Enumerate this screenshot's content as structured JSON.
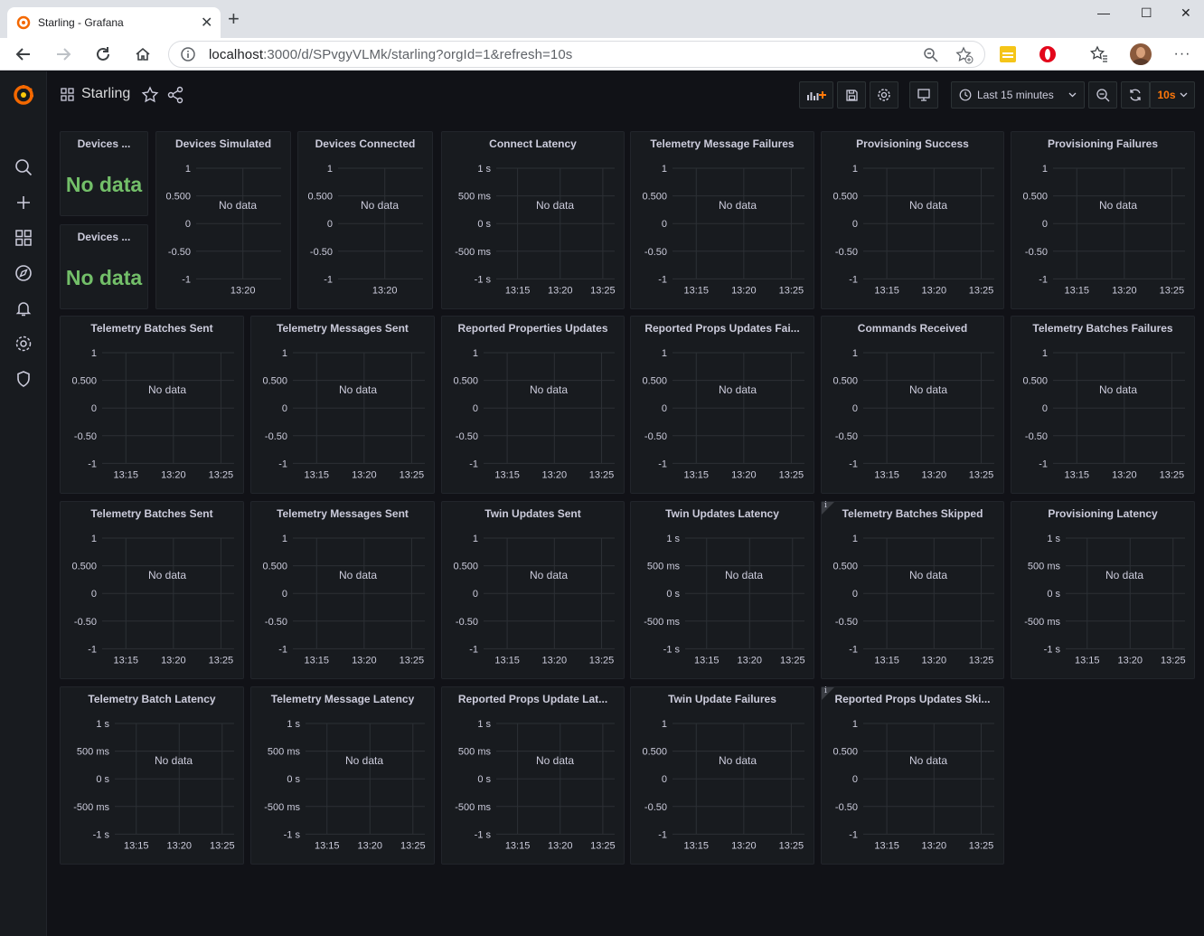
{
  "browser": {
    "tab_title": "Starling - Grafana",
    "url_host": "localhost",
    "url_rest": ":3000/d/SPvgyVLMk/starling?orgId=1&refresh=10s",
    "icons": [
      "back-icon",
      "forward-icon",
      "reload-icon",
      "home-icon",
      "info-icon",
      "zoom-icon",
      "favorite-add-icon",
      "extension-icon",
      "opera-icon",
      "favorites-icon",
      "profile-avatar",
      "more-icon"
    ]
  },
  "sidemenu": {
    "icons": [
      "grafana-logo",
      "search-icon",
      "plus-icon",
      "dashboards-icon",
      "explore-icon",
      "alert-bell-icon",
      "gear-icon",
      "shield-icon"
    ]
  },
  "navbar": {
    "title": "Starling",
    "time_range": "Last 15 minutes",
    "refresh": "10s"
  },
  "colors": {
    "accent": "#ff780a",
    "stat_green": "#73bf69",
    "bg": "#111217",
    "panel": "#181b1f"
  },
  "stat_panels": [
    {
      "title": "Devices ...",
      "value": "No data"
    },
    {
      "title": "Devices ...",
      "value": "No data"
    }
  ],
  "no_data": "No data",
  "axis_sets": {
    "num": [
      "1",
      "0.500",
      "0",
      "-0.50",
      "-1"
    ],
    "ms": [
      "1 s",
      "500 ms",
      "0 s",
      "-500 ms",
      "-1 s"
    ]
  },
  "panels": [
    {
      "title": "Devices Simulated",
      "axis": "num",
      "xticks": [
        "13:20"
      ]
    },
    {
      "title": "Devices Connected",
      "axis": "num",
      "xticks": [
        "13:20"
      ]
    },
    {
      "title": "Connect Latency",
      "axis": "ms",
      "xticks": [
        "13:15",
        "13:20",
        "13:25"
      ]
    },
    {
      "title": "Telemetry Message Failures",
      "axis": "num",
      "xticks": [
        "13:15",
        "13:20",
        "13:25"
      ]
    },
    {
      "title": "Provisioning Success",
      "axis": "num",
      "xticks": [
        "13:15",
        "13:20",
        "13:25"
      ]
    },
    {
      "title": "Provisioning Failures",
      "axis": "num",
      "xticks": [
        "13:15",
        "13:20",
        "13:25"
      ]
    },
    {
      "title": "Telemetry Batches Sent",
      "axis": "num",
      "xticks": [
        "13:15",
        "13:20",
        "13:25"
      ]
    },
    {
      "title": "Telemetry Messages Sent",
      "axis": "num",
      "xticks": [
        "13:15",
        "13:20",
        "13:25"
      ]
    },
    {
      "title": "Reported Properties Updates",
      "axis": "num",
      "xticks": [
        "13:15",
        "13:20",
        "13:25"
      ]
    },
    {
      "title": "Reported Props Updates Fai...",
      "axis": "num",
      "xticks": [
        "13:15",
        "13:20",
        "13:25"
      ]
    },
    {
      "title": "Commands Received",
      "axis": "num",
      "xticks": [
        "13:15",
        "13:20",
        "13:25"
      ]
    },
    {
      "title": "Telemetry Batches Failures",
      "axis": "num",
      "xticks": [
        "13:15",
        "13:20",
        "13:25"
      ]
    },
    {
      "title": "Telemetry Batches Sent",
      "axis": "num",
      "xticks": [
        "13:15",
        "13:20",
        "13:25"
      ]
    },
    {
      "title": "Telemetry Messages Sent",
      "axis": "num",
      "xticks": [
        "13:15",
        "13:20",
        "13:25"
      ]
    },
    {
      "title": "Twin Updates Sent",
      "axis": "num",
      "xticks": [
        "13:15",
        "13:20",
        "13:25"
      ]
    },
    {
      "title": "Twin Updates Latency",
      "axis": "ms",
      "xticks": [
        "13:15",
        "13:20",
        "13:25"
      ]
    },
    {
      "title": "Telemetry Batches Skipped",
      "axis": "num",
      "xticks": [
        "13:15",
        "13:20",
        "13:25"
      ],
      "info": true
    },
    {
      "title": "Provisioning Latency",
      "axis": "ms",
      "xticks": [
        "13:15",
        "13:20",
        "13:25"
      ]
    },
    {
      "title": "Telemetry Batch Latency",
      "axis": "ms",
      "xticks": [
        "13:15",
        "13:20",
        "13:25"
      ]
    },
    {
      "title": "Telemetry Message Latency",
      "axis": "ms",
      "xticks": [
        "13:15",
        "13:20",
        "13:25"
      ]
    },
    {
      "title": "Reported Props Update Lat...",
      "axis": "ms",
      "xticks": [
        "13:15",
        "13:20",
        "13:25"
      ]
    },
    {
      "title": "Twin Update Failures",
      "axis": "num",
      "xticks": [
        "13:15",
        "13:20",
        "13:25"
      ]
    },
    {
      "title": "Reported Props Updates Ski...",
      "axis": "num",
      "xticks": [
        "13:15",
        "13:20",
        "13:25"
      ],
      "info": true
    }
  ]
}
